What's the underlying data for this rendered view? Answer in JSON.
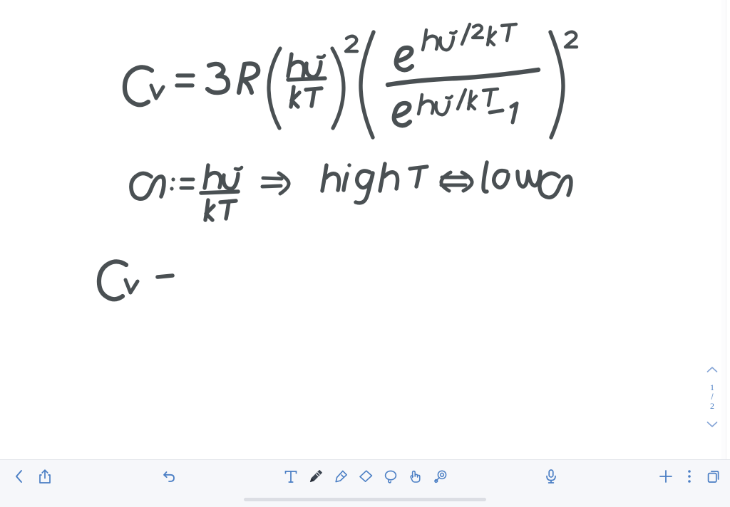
{
  "app": {
    "name": "handwriting-notes-app",
    "ink_color": "#4a5053",
    "accent_color": "#4a7ec4",
    "canvas_color": "#ffffff",
    "toolbar_color": "#f6f7fa",
    "status_dot_color": "#f0b429"
  },
  "notes": {
    "line1": {
      "label": "Cv = 3R (hν/kT)^2 ( e^(hν/2kT) / ( e^(hν/kT) - 1 ) )^2",
      "lhs": "C_V",
      "equals": "=",
      "prefactor": "3R",
      "bracket1_numerator": "hν",
      "bracket1_denominator": "kT",
      "bracket1_exponent": "2",
      "bracket2_numerator": "e^(hν/2kT)",
      "bracket2_denominator": "e^(hν/kT) − 1",
      "bracket2_exponent": "2"
    },
    "line2": {
      "label": "α := hν/kT ⟹ high T ⟺ low α",
      "symbol": "α",
      "defined_as": ":=",
      "numerator": "hν",
      "denominator": "kT",
      "implies": "⟹",
      "statement_left": "high T",
      "iff": "⟺",
      "statement_right": "low α"
    },
    "line3": {
      "label": "C_V −",
      "lhs": "C_V",
      "trailing": "−"
    }
  },
  "page_nav": {
    "up_icon": "chevron-up-icon",
    "current_page": "1",
    "separator": "/",
    "total_pages": "2",
    "down_icon": "chevron-down-icon"
  },
  "toolbar": {
    "back": {
      "label": "Back",
      "icon": "chevron-left-icon"
    },
    "share": {
      "label": "Share",
      "icon": "share-icon"
    },
    "undo": {
      "label": "Undo",
      "icon": "undo-icon"
    },
    "tools": [
      {
        "id": "text",
        "label": "Text",
        "icon": "text-tool-icon",
        "active": false
      },
      {
        "id": "pen",
        "label": "Pen",
        "icon": "pen-tool-icon",
        "active": true
      },
      {
        "id": "highlighter",
        "label": "Highlighter",
        "icon": "highlighter-tool-icon",
        "active": false
      },
      {
        "id": "eraser",
        "label": "Eraser",
        "icon": "eraser-tool-icon",
        "active": false
      },
      {
        "id": "lasso",
        "label": "Lasso Select",
        "icon": "lasso-tool-icon",
        "active": false
      },
      {
        "id": "hand",
        "label": "Hand / Pan",
        "icon": "hand-tool-icon",
        "active": false
      },
      {
        "id": "shape",
        "label": "Shape Assist",
        "icon": "shape-assist-icon",
        "active": false
      }
    ],
    "microphone": {
      "label": "Record Audio",
      "icon": "microphone-icon"
    },
    "add": {
      "label": "Add",
      "icon": "plus-icon"
    },
    "more": {
      "label": "More",
      "icon": "more-vertical-icon"
    },
    "pages": {
      "label": "Pages",
      "icon": "pages-icon"
    }
  },
  "window": {
    "grabber_icon": "window-grabber-icon",
    "home_indicator_icon": "home-indicator"
  }
}
